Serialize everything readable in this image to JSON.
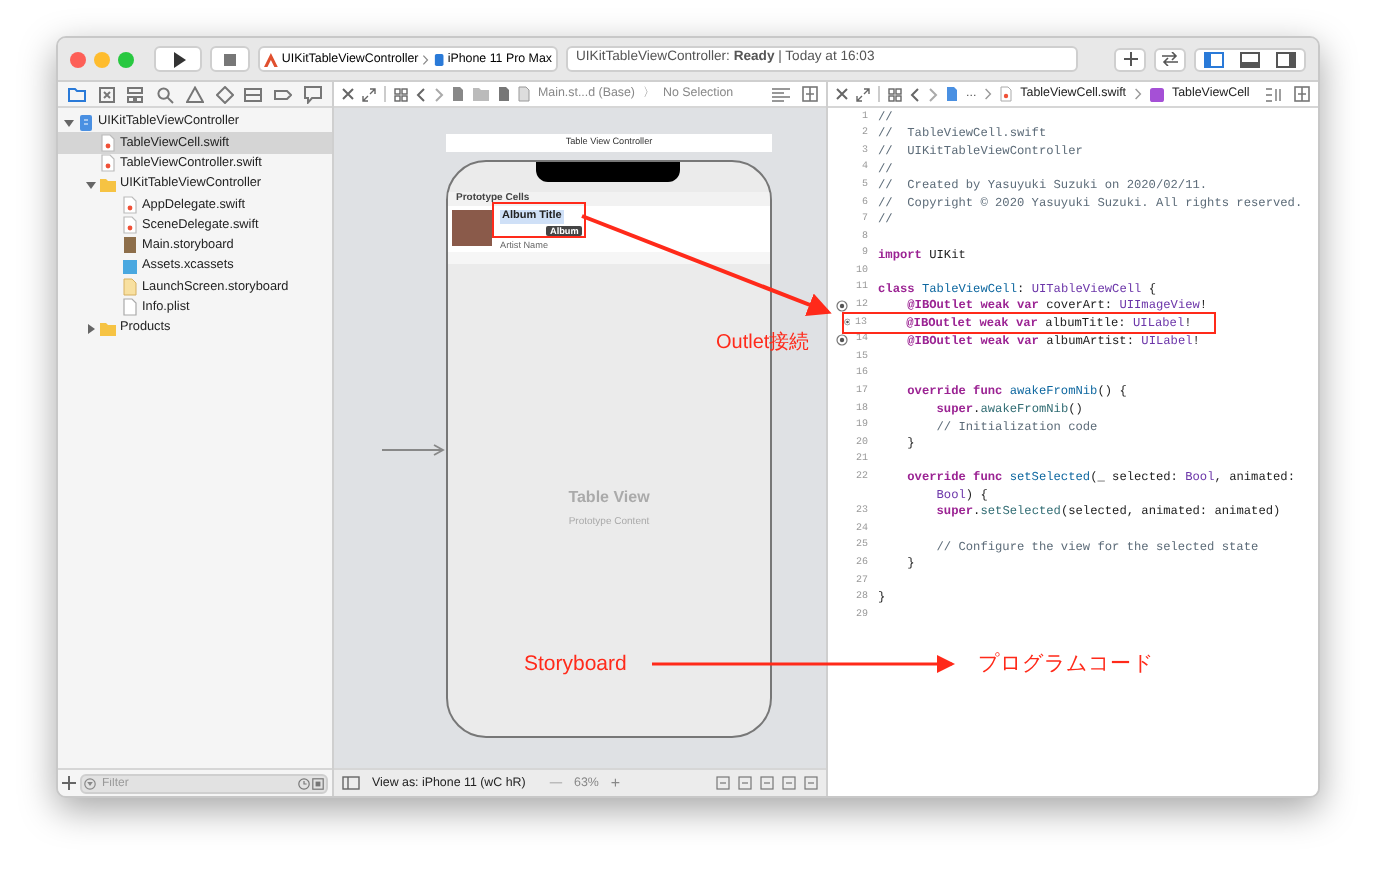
{
  "toolbar": {
    "scheme": "UIKitTableViewController",
    "device": "iPhone 11 Pro Max",
    "status": "UIKitTableViewController: **Ready** | Today at 16:03"
  },
  "navigator": {
    "tabs": [
      {
        "kind": "folder",
        "selected": true
      },
      {
        "kind": "square",
        "selected": false
      },
      {
        "kind": "hierarchy",
        "selected": false
      },
      {
        "kind": "search",
        "selected": false
      },
      {
        "kind": "warning",
        "selected": false
      },
      {
        "kind": "diamond",
        "selected": false
      },
      {
        "kind": "list",
        "selected": false
      },
      {
        "kind": "tag",
        "selected": false
      },
      {
        "kind": "bubble",
        "selected": false
      }
    ],
    "tree": [
      {
        "label": "UIKitTableViewController",
        "kind": "project",
        "expanded": true,
        "selected": false,
        "children": [
          {
            "label": "TableViewCell.swift",
            "kind": "swift",
            "selected": true
          },
          {
            "label": "TableViewController.swift",
            "kind": "swift",
            "selected": false
          },
          {
            "label": "UIKitTableViewController",
            "kind": "folder",
            "expanded": true,
            "selected": false,
            "children": [
              {
                "label": "AppDelegate.swift",
                "kind": "swift",
                "selected": false
              },
              {
                "label": "SceneDelegate.swift",
                "kind": "swift",
                "selected": false
              },
              {
                "label": "Main.storyboard",
                "kind": "storyboard",
                "selected": false
              },
              {
                "label": "Assets.xcassets",
                "kind": "assets",
                "selected": false
              },
              {
                "label": "LaunchScreen.storyboard",
                "kind": "launch",
                "selected": false
              },
              {
                "label": "Info.plist",
                "kind": "plist",
                "selected": false
              }
            ]
          },
          {
            "label": "Products",
            "kind": "folder",
            "expanded": false,
            "selected": false
          }
        ]
      }
    ],
    "filter_placeholder": "Filter"
  },
  "canvas": {
    "jump_bar": {
      "file": "Main.st...d (Base)",
      "separator": "〉",
      "selection": "No Selection"
    },
    "scene_title": "Table View Controller",
    "section_header": "Prototype Cells",
    "cell_title": "Album Title",
    "cell_subtitle": "Artist Name",
    "tooltip": "Album",
    "table_title": "Table View",
    "table_subtitle": "Prototype Content",
    "bottom_bar": {
      "view_as": "View as: iPhone 11 (wC hR)",
      "minus": "—",
      "zoom": "63%",
      "plus": "+"
    }
  },
  "editor": {
    "jump_bar": {
      "folder": "...",
      "file": "TableViewCell.swift",
      "class": "TableViewCell"
    },
    "lines": [
      {
        "number": "1",
        "segments": [
          {
            "kind": "comment",
            "text": "//"
          }
        ]
      },
      {
        "number": "2",
        "segments": [
          {
            "kind": "comment",
            "text": "//  TableViewCell.swift"
          }
        ]
      },
      {
        "number": "3",
        "segments": [
          {
            "kind": "comment",
            "text": "//  UIKitTableViewController"
          }
        ]
      },
      {
        "number": "4",
        "segments": [
          {
            "kind": "comment",
            "text": "//"
          }
        ]
      },
      {
        "number": "5",
        "segments": [
          {
            "kind": "comment",
            "text": "//  Created by Yasuyuki Suzuki on 2020/02/11."
          }
        ]
      },
      {
        "number": "6",
        "segments": [
          {
            "kind": "comment",
            "text": "//  Copyright © 2020 Yasuyuki Suzuki. All rights reserved."
          }
        ]
      },
      {
        "number": "7",
        "segments": [
          {
            "kind": "comment",
            "text": "//"
          }
        ]
      },
      {
        "number": "8"
      },
      {
        "number": "9",
        "segments": [
          {
            "kind": "keyword",
            "text": "import"
          },
          {
            "kind": "plain",
            "text": " UIKit"
          }
        ]
      },
      {
        "number": "10"
      },
      {
        "number": "11",
        "segments": [
          {
            "kind": "keyword",
            "text": "class"
          },
          {
            "kind": "decl",
            "text": " TableViewCell"
          },
          {
            "kind": "plain",
            "text": ": "
          },
          {
            "kind": "type",
            "text": "UITableViewCell"
          },
          {
            "kind": "plain",
            "text": " {"
          }
        ]
      },
      {
        "number": "12",
        "outlet": true,
        "segments": [
          {
            "kind": "keyword",
            "text": "    @IBOutlet weak var"
          },
          {
            "kind": "plain",
            "text": " coverArt: "
          },
          {
            "kind": "type",
            "text": "UIImageView"
          },
          {
            "kind": "plain",
            "text": "!"
          }
        ]
      },
      {
        "number": "13",
        "outlet": true,
        "highlighted": true,
        "segments": [
          {
            "kind": "keyword",
            "text": "    @IBOutlet weak var"
          },
          {
            "kind": "plain",
            "text": " albumTitle: "
          },
          {
            "kind": "type",
            "text": "UILabel"
          },
          {
            "kind": "plain",
            "text": "!"
          }
        ]
      },
      {
        "number": "14",
        "outlet": true,
        "segments": [
          {
            "kind": "keyword",
            "text": "    @IBOutlet weak var"
          },
          {
            "kind": "plain",
            "text": " albumArtist: "
          },
          {
            "kind": "type",
            "text": "UILabel"
          },
          {
            "kind": "plain",
            "text": "!"
          }
        ]
      },
      {
        "number": "15"
      },
      {
        "number": "16"
      },
      {
        "number": "17",
        "segments": [
          {
            "kind": "keyword",
            "text": "    override func"
          },
          {
            "kind": "decl",
            "text": " awakeFromNib"
          },
          {
            "kind": "plain",
            "text": "() {"
          }
        ]
      },
      {
        "number": "18",
        "segments": [
          {
            "kind": "keyword",
            "text": "        super"
          },
          {
            "kind": "plain",
            "text": "."
          },
          {
            "kind": "call",
            "text": "awakeFromNib"
          },
          {
            "kind": "plain",
            "text": "()"
          }
        ]
      },
      {
        "number": "19",
        "segments": [
          {
            "kind": "comment",
            "text": "        // Initialization code"
          }
        ]
      },
      {
        "number": "20",
        "segments": [
          {
            "kind": "plain",
            "text": "    }"
          }
        ]
      },
      {
        "number": "21"
      },
      {
        "number": "22",
        "segments": [
          {
            "kind": "keyword",
            "text": "    override func"
          },
          {
            "kind": "decl",
            "text": " setSelected"
          },
          {
            "kind": "plain",
            "text": "(_ selected: "
          },
          {
            "kind": "type",
            "text": "Bool"
          },
          {
            "kind": "plain",
            "text": ", animated:"
          }
        ]
      },
      {
        "segments": [
          {
            "kind": "type",
            "text": "        Bool"
          },
          {
            "kind": "plain",
            "text": ") {"
          }
        ]
      },
      {
        "number": "23",
        "segments": [
          {
            "kind": "keyword",
            "text": "        super"
          },
          {
            "kind": "plain",
            "text": "."
          },
          {
            "kind": "call",
            "text": "setSelected"
          },
          {
            "kind": "plain",
            "text": "(selected, animated: animated)"
          }
        ]
      },
      {
        "number": "24"
      },
      {
        "number": "25",
        "segments": [
          {
            "kind": "comment",
            "text": "        // Configure the view for the selected state"
          }
        ]
      },
      {
        "number": "26",
        "segments": [
          {
            "kind": "plain",
            "text": "    }"
          }
        ]
      },
      {
        "number": "27"
      },
      {
        "number": "28",
        "segments": [
          {
            "kind": "plain",
            "text": "}"
          }
        ]
      },
      {
        "number": "29"
      }
    ]
  },
  "annotations": {
    "outlet_label": "Outlet接続",
    "left_label": "Storyboard",
    "right_label": "プログラムコード"
  }
}
